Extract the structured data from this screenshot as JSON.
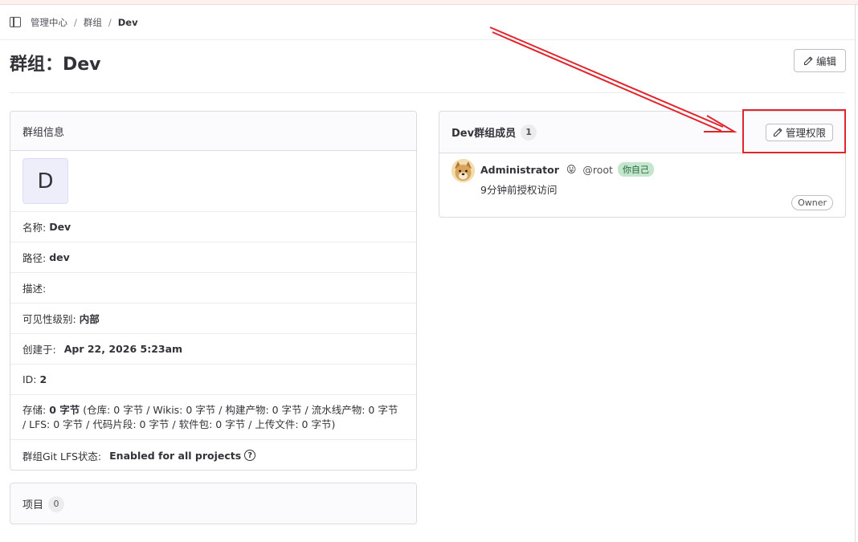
{
  "breadcrumb": {
    "items": [
      "管理中心",
      "群组",
      "Dev"
    ],
    "separator": "/"
  },
  "header": {
    "title": "群组：Dev",
    "edit_label": "编辑"
  },
  "group_info": {
    "heading": "群组信息",
    "avatar_letter": "D",
    "name_label": "名称:",
    "name_value": "Dev",
    "path_label": "路径:",
    "path_value": "dev",
    "description_label": "描述:",
    "visibility_label": "可见性级别:",
    "visibility_value": "内部",
    "created_label": "创建于:",
    "created_value": "Apr 22, 2026 5:23am",
    "id_label": "ID:",
    "id_value": "2",
    "storage_label": "存储:",
    "storage_value": "0 字节",
    "storage_detail": "(仓库: 0 字节 / Wikis: 0 字节 / 构建产物: 0 字节 / 流水线产物: 0 字节 / LFS: 0 字节 / 代码片段: 0 字节 / 软件包: 0 字节 / 上传文件: 0 字节)",
    "lfs_label": "群组Git LFS状态:",
    "lfs_value": "Enabled for all projects"
  },
  "projects": {
    "heading": "项目",
    "count": "0"
  },
  "members": {
    "heading": "Dev群组成员",
    "count": "1",
    "manage_label": "管理权限",
    "list": [
      {
        "name": "Administrator",
        "emoji": "😛",
        "username": "@root",
        "self_badge": "你自己",
        "access": "9分钟前授权访问",
        "role": "Owner"
      }
    ]
  },
  "colors": {
    "highlight": "#e0262c",
    "self_badge_bg": "#c3e6cd",
    "avatar_bg": "#eeeefb"
  }
}
